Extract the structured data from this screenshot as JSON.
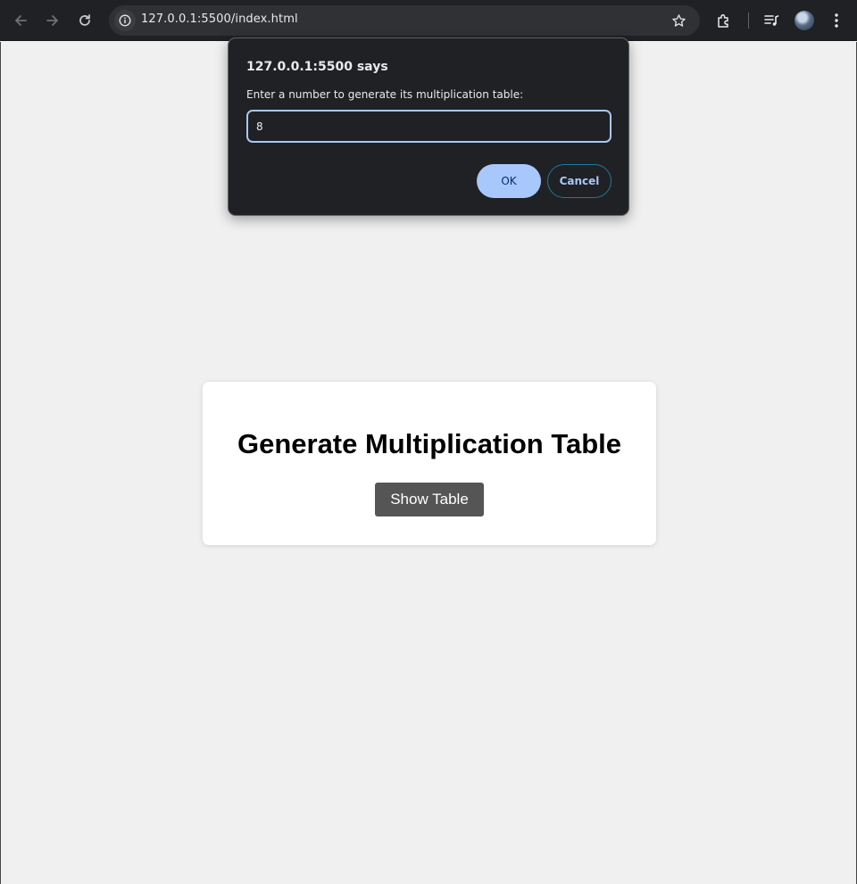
{
  "browser": {
    "url": "127.0.0.1:5500/index.html",
    "icons": [
      "back-icon",
      "forward-icon",
      "reload-icon",
      "site-info-icon",
      "bookmark-star-icon",
      "extensions-icon",
      "media-controls-icon",
      "profile-avatar",
      "more-menu-icon"
    ],
    "colors": {
      "toolbar": "#202124",
      "omnibox": "#303134",
      "text": "#e8eaed"
    }
  },
  "dialog": {
    "title": "127.0.0.1:5500 says",
    "message": "Enter a number to generate its multiplication table:",
    "input_value": "8",
    "ok_label": "OK",
    "cancel_label": "Cancel",
    "colors": {
      "background": "#202124",
      "accent": "#a8c7fa"
    }
  },
  "page": {
    "heading": "Generate Multiplication Table",
    "button_label": "Show Table",
    "colors": {
      "background": "#f0f0f0",
      "card": "#ffffff",
      "button": "#555555"
    }
  }
}
